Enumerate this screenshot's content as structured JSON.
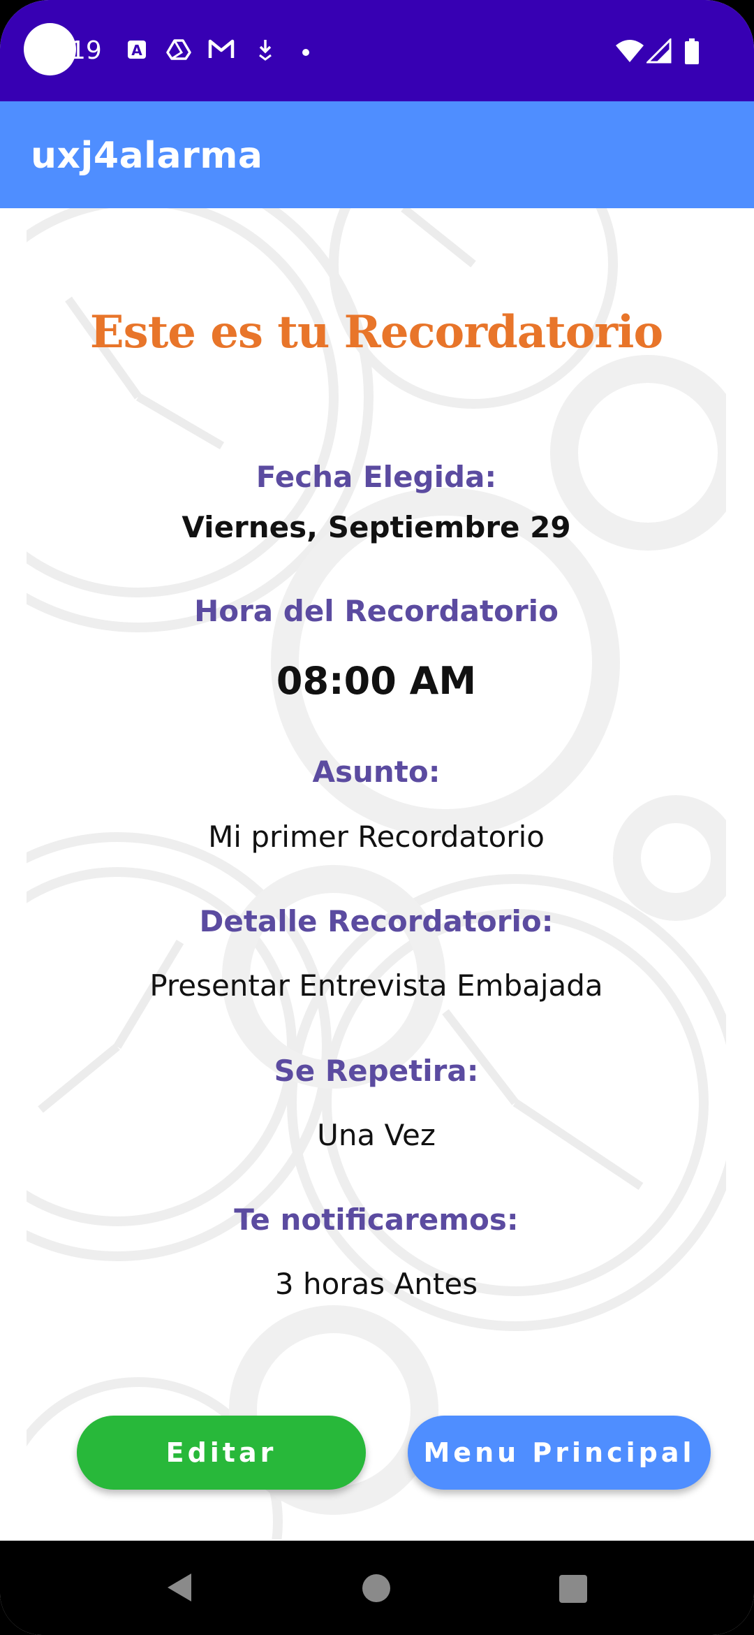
{
  "status_bar": {
    "time": "19",
    "icons": [
      "app-a-icon",
      "drive-icon",
      "gmail-icon",
      "download-icon",
      "dot-icon",
      "wifi-icon",
      "signal-icon",
      "battery-icon"
    ]
  },
  "app_bar": {
    "title": "uxj4alarma"
  },
  "screen": {
    "title": "Este es tu Recordatorio",
    "fecha_label": "Fecha Elegida:",
    "fecha_value": "Viernes, Septiembre 29",
    "hora_label": "Hora del Recordatorio",
    "hora_value": "08:00 AM",
    "asunto_label": "Asunto:",
    "asunto_value": "Mi primer Recordatorio",
    "detalle_label": "Detalle Recordatorio:",
    "detalle_value": "Presentar Entrevista Embajada",
    "repetira_label": "Se Repetira:",
    "repetira_value": "Una Vez",
    "notificaremos_label": "Te notificaremos:",
    "notificaremos_value": "3 horas Antes"
  },
  "buttons": {
    "edit_label": "Editar",
    "menu_label": "Menu Principal"
  },
  "colors": {
    "status_bar": "#3700b3",
    "app_bar": "#4f8eff",
    "title": "#e8752a",
    "label": "#5b4ba0",
    "edit_button": "#28b83a",
    "menu_button": "#4f8eff"
  },
  "nav_bar": {
    "icons": [
      "back-icon",
      "home-icon",
      "recents-icon"
    ]
  }
}
